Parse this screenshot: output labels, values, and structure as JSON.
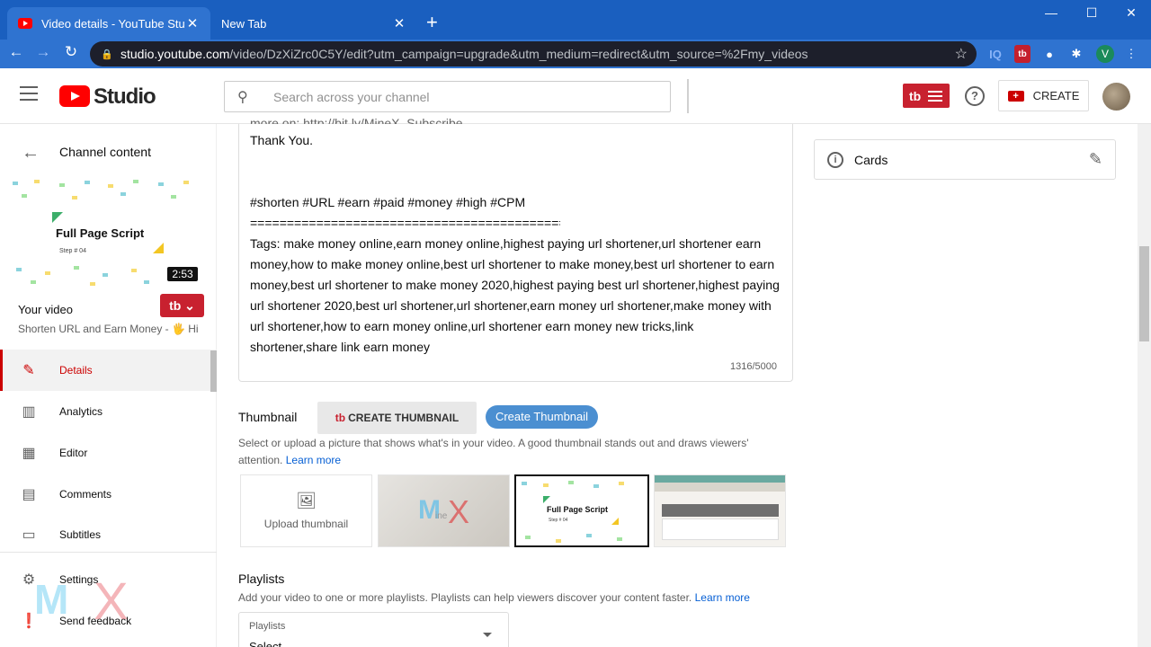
{
  "browser": {
    "tabs": [
      {
        "title": "Video details - YouTube Studio"
      },
      {
        "title": "New Tab"
      }
    ],
    "url_domain": "studio.youtube.com",
    "url_path": "/video/DzXiZrc0C5Y/edit?utm_campaign=upgrade&utm_medium=redirect&utm_source=%2Fmy_videos",
    "extensions": {
      "iq": "IQ",
      "tb": "tb",
      "profile_initial": "V"
    }
  },
  "header": {
    "logo_text": "Studio",
    "search_placeholder": "Search across your channel",
    "tb_label": "tb",
    "create_label": "CREATE"
  },
  "sidebar": {
    "back_label": "Channel content",
    "thumb_title": "Full Page Script",
    "thumb_sub": "Step # 04",
    "duration": "2:53",
    "your_video": "Your video",
    "video_title": "Shorten URL and Earn Money - 🖐 Hi...",
    "tb_label": "tb",
    "items": [
      {
        "label": "Details",
        "icon": "pencil-icon"
      },
      {
        "label": "Analytics",
        "icon": "analytics-icon"
      },
      {
        "label": "Editor",
        "icon": "clapper-icon"
      },
      {
        "label": "Comments",
        "icon": "comments-icon"
      },
      {
        "label": "Subtitles",
        "icon": "subtitles-icon"
      },
      {
        "label": "Settings",
        "icon": "gear-icon"
      },
      {
        "label": "Send feedback",
        "icon": "feedback-icon"
      }
    ],
    "watermark": {
      "m": "M",
      "x": "X"
    }
  },
  "description": {
    "cut_line": "more on: http://bit.ly/MineX_Subscribe",
    "thank_you": "Thank You.",
    "hashtags": "#shorten #URL #earn #paid #money #high #CPM",
    "separator": "============================================",
    "tags": "Tags: make money online,earn money online,highest paying url shortener,url shortener earn money,how to make money online,best url shortener to make money,best url shortener to earn money,best url shortener to make money 2020,highest paying best url shortener,highest paying url shortener 2020,best url shortener,url shortener,earn money url shortener,make money with url shortener,how to earn money online,url shortener earn money new tricks,link shortener,share link earn money",
    "count": "1316/5000"
  },
  "cards": {
    "label": "Cards"
  },
  "thumbnail": {
    "label": "Thumbnail",
    "create_btn_1": "CREATE THUMBNAIL",
    "create_btn_1_mark": "tb",
    "create_btn_2": "Create Thumbnail",
    "help": "Select or upload a picture that shows what's in your video. A good thumbnail stands out and draws viewers' attention.",
    "learn_more": "Learn more",
    "upload_label": "Upload thumbnail",
    "mx_m": "M",
    "mx_ine": "ine",
    "mx_x": "X",
    "fps_title": "Full Page Script",
    "fps_sub": "Step # 04"
  },
  "playlists": {
    "label": "Playlists",
    "help": "Add your video to one or more playlists. Playlists can help viewers discover your content faster.",
    "learn_more": "Learn more",
    "select_label": "Playlists",
    "select_value": "Select"
  },
  "colors": {
    "brand_red": "#ff0000",
    "accent_blue": "#065fd4",
    "chrome_blue": "#1a5fbf"
  }
}
